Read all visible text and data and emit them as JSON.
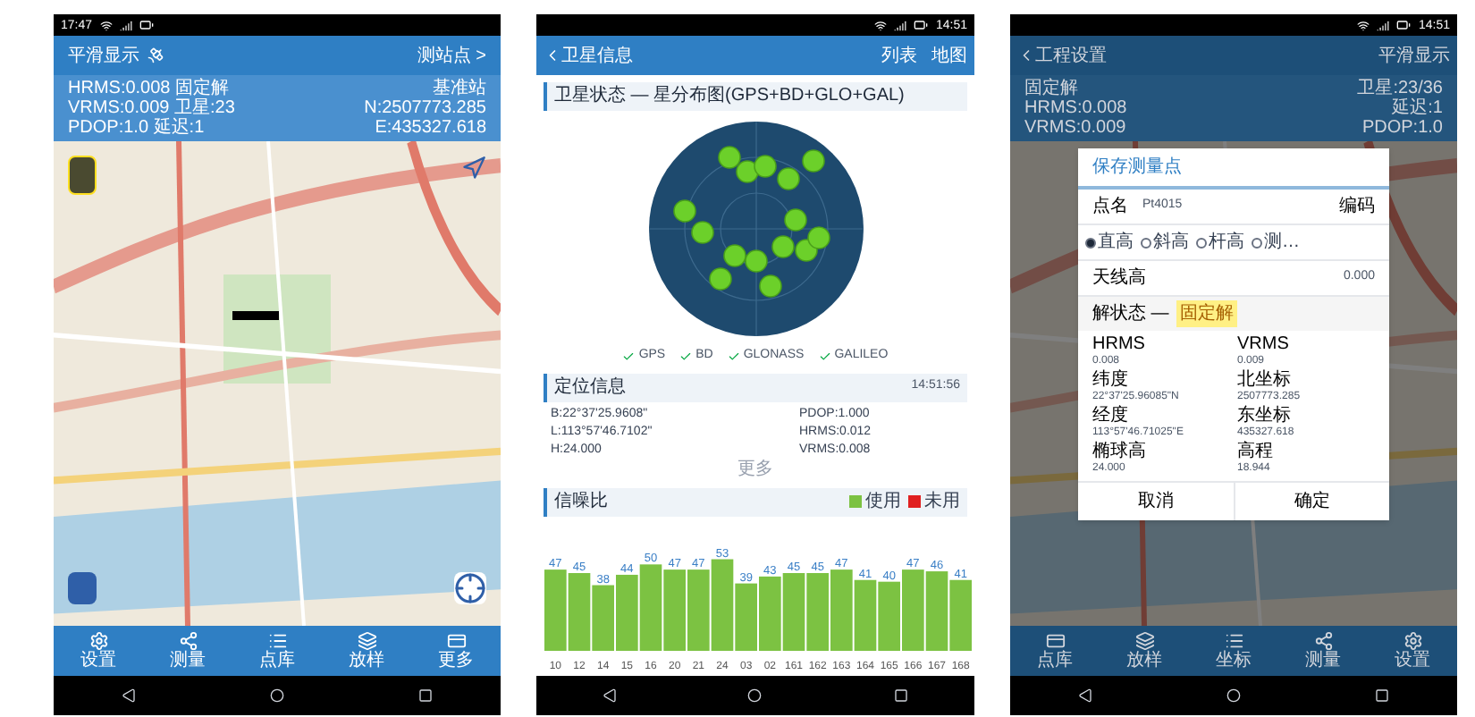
{
  "map_screen": {
    "status_time": "17:47",
    "title": "平滑显示",
    "action": "测站点 >",
    "info_left": [
      "HRMS:0.008 固定解",
      "VRMS:0.009 卫星:23",
      "PDOP:1.0 延迟:1"
    ],
    "info_right": [
      "基准站",
      "N:2507773.285",
      "E:435327.618"
    ],
    "nav": [
      {
        "label": "设置",
        "kind": "gear"
      },
      {
        "label": "测量",
        "kind": "nodes"
      },
      {
        "label": "点库",
        "kind": "list"
      },
      {
        "label": "放样",
        "kind": "layers"
      },
      {
        "label": "更多",
        "kind": "card"
      }
    ]
  },
  "satellite_screen": {
    "status_time": "14:51",
    "title": "卫星信息",
    "actions": [
      "列表",
      "地图"
    ],
    "sky_header": "卫星状态 — 星分布图(GPS+BD+GLO+GAL)",
    "systems": [
      {
        "label": "GPS",
        "checked": true
      },
      {
        "label": "BD",
        "checked": true
      },
      {
        "label": "GLONASS",
        "checked": true
      },
      {
        "label": "GALILEO",
        "checked": true
      }
    ],
    "position_header": "定位信息",
    "position_time": "14:51:56",
    "position_left": [
      "B:22°37'25.9608\"",
      "L:113°57'46.7102\"",
      "H:24.000"
    ],
    "position_right": [
      "PDOP:1.000",
      "HRMS:0.012",
      "VRMS:0.008"
    ],
    "more": "更多",
    "snr_header": "信噪比",
    "legend": [
      {
        "label": "未用",
        "color": "#e02020"
      }
    ],
    "chart_data": {
      "type": "bar",
      "categories": [
        "10",
        "12",
        "14",
        "15",
        "16",
        "20",
        "21",
        "24",
        "03",
        "02",
        "161",
        "162",
        "163",
        "164",
        "165",
        "166",
        "167",
        "168"
      ],
      "series": [
        {
          "name": "使用",
          "color": "#7cc242",
          "values": [
            47,
            45,
            38,
            44,
            50,
            47,
            47,
            53,
            39,
            43,
            45,
            45,
            47,
            41,
            40,
            47,
            46,
            41
          ]
        }
      ],
      "data_labels": true
    }
  },
  "dialog_screen": {
    "status_time": "14:51",
    "title": "工程设置",
    "action": "平滑显示",
    "info_left": [
      "固定解",
      "HRMS:0.008",
      "VRMS:0.009"
    ],
    "info_right": [
      "卫星:23/36",
      "延迟:1",
      "PDOP:1.0"
    ],
    "dialog": {
      "title": "保存测量点",
      "name_label": "点名",
      "name_value": "Pt4015",
      "code_label": "编码",
      "heights": [
        {
          "label": "直高",
          "selected": true
        },
        {
          "label": "斜高",
          "selected": false
        },
        {
          "label": "杆高",
          "selected": false
        },
        {
          "label": "测…",
          "selected": false
        }
      ],
      "antenna_label": "天线高",
      "antenna_value": "0.000",
      "solution_label": "解状态 —",
      "solution_value": "固定解",
      "fields": [
        {
          "label": "HRMS",
          "value": "0.008"
        },
        {
          "label": "VRMS",
          "value": "0.009"
        },
        {
          "label": "纬度",
          "value": "22°37'25.96085\"N"
        },
        {
          "label": "北坐标",
          "value": "2507773.285"
        },
        {
          "label": "经度",
          "value": "113°57'46.71025\"E"
        },
        {
          "label": "东坐标",
          "value": "435327.618"
        },
        {
          "label": "椭球高",
          "value": "24.000"
        },
        {
          "label": "高程",
          "value": "18.944"
        }
      ],
      "buttons": [
        "取消",
        "确定"
      ]
    },
    "nav": [
      {
        "label": "点库",
        "kind": "card"
      },
      {
        "label": "放样",
        "kind": "layers"
      },
      {
        "label": "坐标",
        "kind": "list"
      },
      {
        "label": "测量",
        "kind": "nodes"
      },
      {
        "label": "设置",
        "kind": "gear"
      }
    ]
  }
}
